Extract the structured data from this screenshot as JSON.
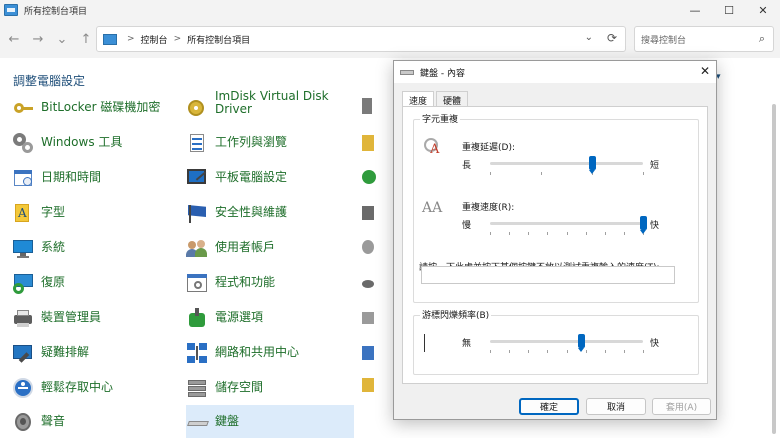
{
  "window": {
    "title": "所有控制台項目",
    "minimize": "—",
    "maximize": "☐",
    "close": "✕"
  },
  "nav": {
    "back": "←",
    "forward": "→",
    "recent": "⌄",
    "up": "↑"
  },
  "address": {
    "crumbs": [
      "控制台",
      "所有控制台項目"
    ],
    "separator": ">",
    "dropdown": "⌄",
    "refresh": "⟳"
  },
  "search": {
    "placeholder": "搜尋控制台",
    "icon": "⌕"
  },
  "page": {
    "title": "調整電腦設定",
    "view_arrow": "▾"
  },
  "items_col1": [
    {
      "label": "BitLocker 磁碟機加密",
      "icon": "key-icon"
    },
    {
      "label": "Windows 工具",
      "icon": "gears-icon"
    },
    {
      "label": "日期和時間",
      "icon": "calendar-icon"
    },
    {
      "label": "字型",
      "icon": "font-icon"
    },
    {
      "label": "系統",
      "icon": "monitor-icon"
    },
    {
      "label": "復原",
      "icon": "recovery-icon"
    },
    {
      "label": "裝置管理員",
      "icon": "printer-device-icon"
    },
    {
      "label": "疑難排解",
      "icon": "troubleshoot-icon"
    },
    {
      "label": "輕鬆存取中心",
      "icon": "accessibility-icon"
    },
    {
      "label": "聲音",
      "icon": "speaker-icon"
    }
  ],
  "items_col2": [
    {
      "label": "ImDisk Virtual Disk Driver",
      "icon": "disk-icon"
    },
    {
      "label": "工作列與瀏覽",
      "icon": "taskbar-icon"
    },
    {
      "label": "平板電腦設定",
      "icon": "tablet-icon"
    },
    {
      "label": "安全性與維護",
      "icon": "flag-icon"
    },
    {
      "label": "使用者帳戶",
      "icon": "users-icon"
    },
    {
      "label": "程式和功能",
      "icon": "programs-icon"
    },
    {
      "label": "電源選項",
      "icon": "power-icon"
    },
    {
      "label": "網路和共用中心",
      "icon": "network-icon"
    },
    {
      "label": "儲存空間",
      "icon": "storage-icon"
    },
    {
      "label": "鍵盤",
      "icon": "keyboard-icon"
    }
  ],
  "dialog": {
    "title": "鍵盤 - 內容",
    "close": "✕",
    "tabs": [
      "速度",
      "硬體"
    ],
    "repeat_group": {
      "title": "字元重複",
      "delay_label": "重複延遲(D):",
      "delay_left": "長",
      "delay_right": "短",
      "delay_value": 0.67,
      "rate_label": "重複速度(R):",
      "rate_left": "慢",
      "rate_right": "快",
      "rate_value": 1.0,
      "test_label": "請按一下此處並按下某個按鍵不放以測試重複輸入的速度(T):"
    },
    "blink_group": {
      "title": "游標閃爍頻率(B)",
      "left": "無",
      "right": "快",
      "value": 0.6
    },
    "buttons": {
      "ok": "確定",
      "cancel": "取消",
      "apply": "套用(A)"
    }
  },
  "colors": {
    "accent": "#0067c0",
    "link_green": "#1e6e2a",
    "title_blue": "#1e4e79"
  }
}
